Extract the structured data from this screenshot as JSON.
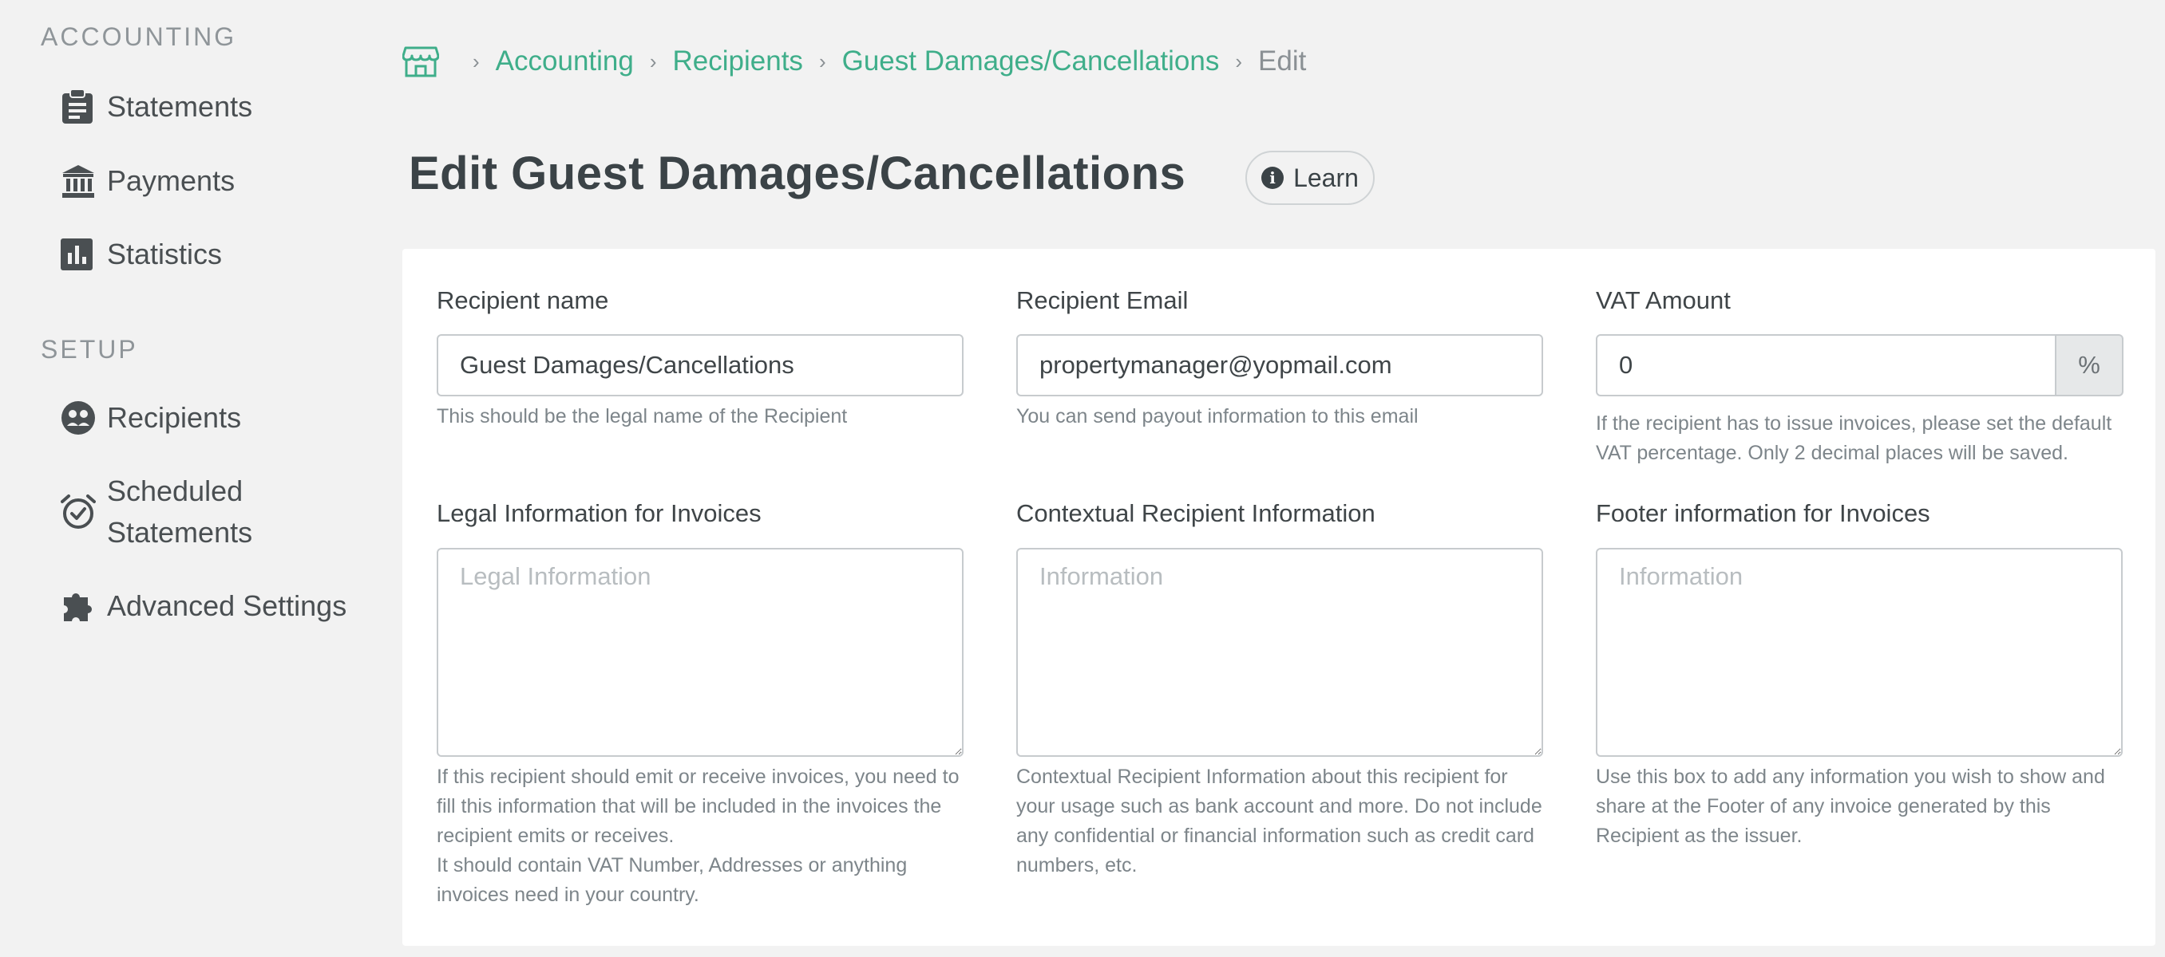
{
  "sidebar": {
    "accounting_title": "ACCOUNTING",
    "setup_title": "SETUP",
    "items": [
      {
        "label": "Statements",
        "icon": "clipboard-icon"
      },
      {
        "label": "Payments",
        "icon": "bank-icon"
      },
      {
        "label": "Statistics",
        "icon": "bar-chart-icon"
      },
      {
        "label": "Recipients",
        "icon": "smiley-group-icon"
      },
      {
        "label_line1": "Scheduled",
        "label_line2": "Statements",
        "icon": "alarm-clock-icon"
      },
      {
        "label": "Advanced Settings",
        "icon": "puzzle-icon"
      }
    ]
  },
  "breadcrumb": {
    "items": [
      "Accounting",
      "Recipients",
      "Guest Damages/Cancellations"
    ],
    "current": "Edit"
  },
  "page": {
    "title": "Edit Guest Damages/Cancellations",
    "learn_label": "Learn"
  },
  "form": {
    "recipient_name": {
      "label": "Recipient name",
      "value": "Guest Damages/Cancellations",
      "help": "This should be the legal name of the Recipient"
    },
    "recipient_email": {
      "label": "Recipient Email",
      "value": "propertymanager@yopmail.com",
      "help": "You can send payout information to this email"
    },
    "vat_amount": {
      "label": "VAT Amount",
      "value": "0",
      "addon": "%",
      "help_line1": "If the recipient has to issue invoices, please set the default",
      "help_line2": "VAT percentage. Only 2 decimal places will be saved."
    },
    "legal_info": {
      "label": "Legal Information for Invoices",
      "placeholder": "Legal Information",
      "help_lines": [
        "If this recipient should emit or receive invoices, you need to",
        "fill this information that will be included in the invoices the",
        "recipient emits or receives.",
        "It should contain VAT Number, Addresses or anything",
        "invoices need in your country."
      ]
    },
    "contextual_info": {
      "label": "Contextual Recipient Information",
      "placeholder": "Information",
      "help_lines": [
        "Contextual Recipient Information about this recipient for",
        "your usage such as bank account and more. Do not include",
        "any confidential or financial information such as credit card",
        "numbers, etc."
      ]
    },
    "footer_info": {
      "label": "Footer information for Invoices",
      "placeholder": "Information",
      "help_lines": [
        "Use this box to add any information you wish to show and",
        "share at the Footer of any invoice generated by this",
        "Recipient as the issuer."
      ]
    }
  },
  "colors": {
    "accent": "#3fae8a",
    "background": "#f2f2f2",
    "text": "#3f4548",
    "muted": "#7d858a"
  }
}
